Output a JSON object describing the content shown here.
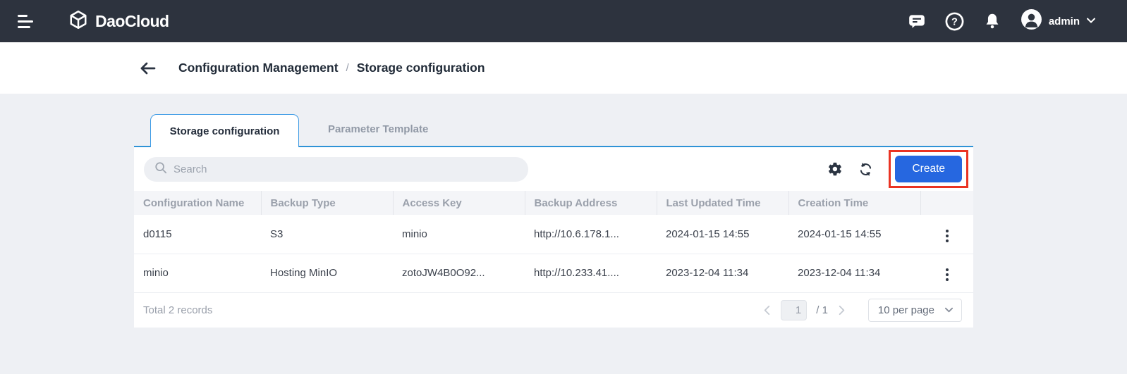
{
  "navbar": {
    "brand": "DaoCloud",
    "user": "admin"
  },
  "breadcrumb": {
    "items": [
      "Configuration Management",
      "Storage configuration"
    ],
    "separator": "/"
  },
  "tabs": {
    "active": "Storage configuration",
    "inactive": "Parameter Template"
  },
  "toolbar": {
    "search_placeholder": "Search",
    "create_label": "Create"
  },
  "table": {
    "columns": [
      "Configuration Name",
      "Backup Type",
      "Access Key",
      "Backup Address",
      "Last Updated Time",
      "Creation Time"
    ],
    "rows": [
      [
        "d0115",
        "S3",
        "minio",
        "http://10.6.178.1...",
        "2024-01-15 14:55",
        "2024-01-15 14:55"
      ],
      [
        "minio",
        "Hosting MinIO",
        "zotoJW4B0O92...",
        "http://10.233.41....",
        "2023-12-04 11:34",
        "2023-12-04 11:34"
      ]
    ]
  },
  "footer": {
    "total": "Total 2 records",
    "page_value": "1",
    "page_total": "/ 1",
    "page_size": "10 per page"
  },
  "colors": {
    "navbar_bg": "#2d333e",
    "accent_blue": "#2667e0",
    "tab_border": "#3e9be5",
    "annotation_red": "#ea3323",
    "page_bg": "#eef0f4"
  }
}
